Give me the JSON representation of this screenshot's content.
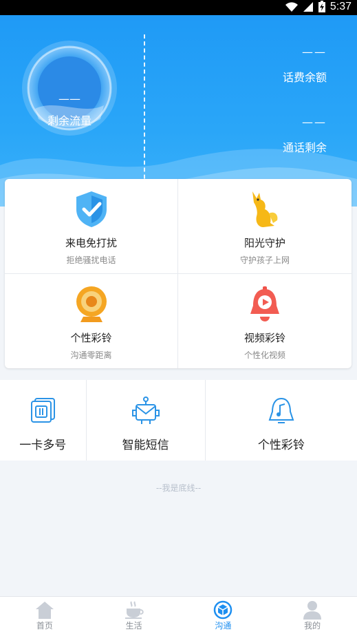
{
  "status_bar": {
    "time": "5:37"
  },
  "hero": {
    "data_remaining": {
      "value": "——",
      "label": "剩余流量"
    },
    "balance": {
      "value": "——",
      "label": "话费余额"
    },
    "call_remaining": {
      "value": "——",
      "label": "通话剩余"
    }
  },
  "features": [
    {
      "title": "来电免打扰",
      "subtitle": "拒绝骚扰电话",
      "icon": "shield-check-icon"
    },
    {
      "title": "阳光守护",
      "subtitle": "守护孩子上网",
      "icon": "kangaroo-icon"
    },
    {
      "title": "个性彩铃",
      "subtitle": "沟通零距离",
      "icon": "ring-speaker-icon"
    },
    {
      "title": "视频彩铃",
      "subtitle": "个性化视频",
      "icon": "video-bell-icon"
    }
  ],
  "quick_actions": [
    {
      "label": "一卡多号",
      "icon": "sim-cards-icon"
    },
    {
      "label": "智能短信",
      "icon": "robot-mail-icon"
    },
    {
      "label": "个性彩铃",
      "icon": "music-bell-icon"
    }
  ],
  "footer_text": "--我是底线--",
  "tabs": [
    {
      "label": "首页",
      "icon": "home-icon",
      "active": false
    },
    {
      "label": "生活",
      "icon": "coffee-cup-icon",
      "active": false
    },
    {
      "label": "沟通",
      "icon": "cube-chat-icon",
      "active": true
    },
    {
      "label": "我的",
      "icon": "person-icon",
      "active": false
    }
  ],
  "colors": {
    "primary": "#1e8ff0",
    "hero_top": "#1f9af6",
    "tab_inactive": "#8a8f96"
  }
}
